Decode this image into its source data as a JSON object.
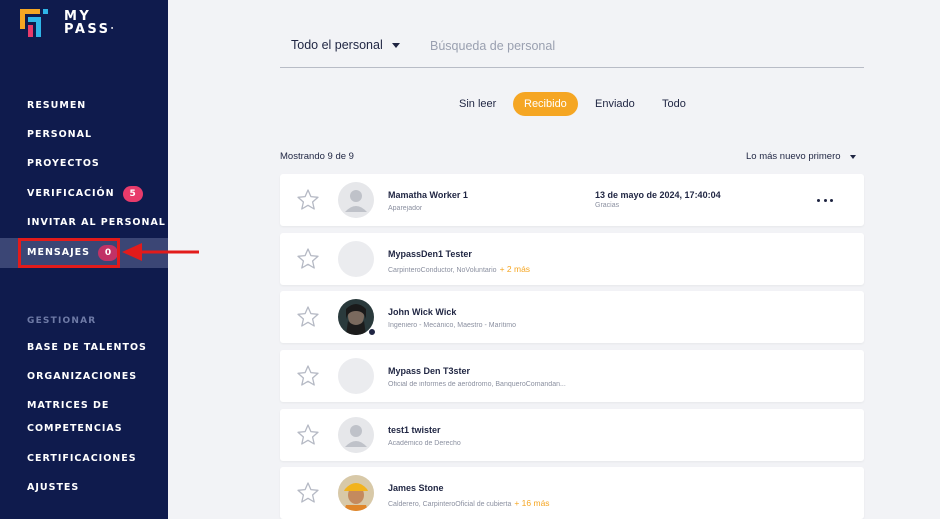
{
  "brand": {
    "line1": "MY",
    "line2": "PASS"
  },
  "sidebar": {
    "items": [
      {
        "label": "RESUMEN"
      },
      {
        "label": "PERSONAL"
      },
      {
        "label": "PROYECTOS"
      },
      {
        "label": "VERIFICACIÓN",
        "badge": "5"
      },
      {
        "label": "INVITAR AL PERSONAL"
      },
      {
        "label": "MENSAJES",
        "badge": "0"
      }
    ],
    "section_label": "GESTIONAR",
    "manage_items": [
      {
        "label": "BASE DE TALENTOS"
      },
      {
        "label": "ORGANIZACIONES"
      },
      {
        "label": "MATRICES DE"
      },
      {
        "label": "COMPETENCIAS"
      },
      {
        "label": "CERTIFICACIONES"
      },
      {
        "label": "AJUSTES"
      }
    ]
  },
  "filter": {
    "selected": "Todo el personal",
    "search_placeholder": "Búsqueda de personal",
    "search_value": ""
  },
  "tabs": [
    {
      "label": "Sin leer"
    },
    {
      "label": "Recibido",
      "active": true
    },
    {
      "label": "Enviado"
    },
    {
      "label": "Todo"
    }
  ],
  "list": {
    "showing": "Mostrando 9 de 9",
    "sort": "Lo más nuevo primero",
    "messages": [
      {
        "name": "Mamatha Worker 1",
        "role": "Aparejador",
        "more": "",
        "date": "13 de mayo de 2024, 17:40:04",
        "message": "Gracias",
        "avatar": "placeholder"
      },
      {
        "name": "MypassDen1 Tester",
        "role": "CarpinteroConductor, NoVoluntario",
        "more": "+ 2 más",
        "date": "",
        "message": "",
        "avatar": "blank"
      },
      {
        "name": "John Wick Wick",
        "role": "Ingeniero - Mecánico, Maestro - Marítimo",
        "more": "",
        "date": "",
        "message": "",
        "avatar": "photo-dark"
      },
      {
        "name": "Mypass Den T3ster",
        "role": "Oficial de informes de aeródromo, BanqueroComandan...",
        "more": "",
        "date": "",
        "message": "",
        "avatar": "blank"
      },
      {
        "name": "test1 twister",
        "role": "Académico de Derecho",
        "more": "",
        "date": "",
        "message": "",
        "avatar": "placeholder"
      },
      {
        "name": "James Stone",
        "role": "Calderero, CarpinteroOficial de cubierta",
        "more": "+ 16 más",
        "date": "",
        "message": "",
        "avatar": "photo-helmet"
      }
    ]
  },
  "colors": {
    "sidebar_bg": "#0f1b4d",
    "accent": "#f5a623",
    "badge": "#e83b6b",
    "highlight": "#e21b1b",
    "text": "#1f2542"
  }
}
